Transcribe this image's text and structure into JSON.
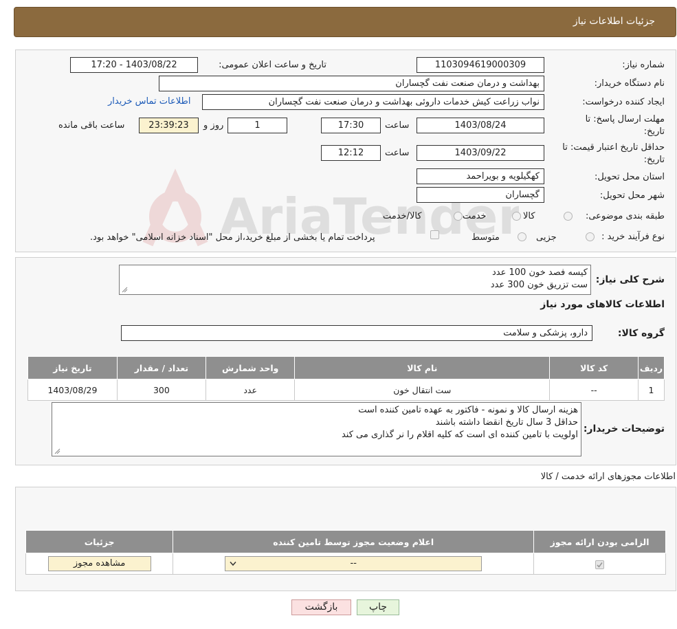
{
  "header": {
    "title": "جزئیات اطلاعات نیاز"
  },
  "form": {
    "need_number": {
      "label": "شماره نیاز:",
      "value": "1103094619000309"
    },
    "announce_datetime": {
      "label": "تاریخ و ساعت اعلان عمومی:",
      "value": "1403/08/22 - 17:20"
    },
    "buyer_org": {
      "label": "نام دستگاه خریدار:",
      "value": "بهداشت و درمان صنعت نفت گچساران"
    },
    "requester": {
      "label": "ایجاد کننده درخواست:",
      "value": "نواب زراعت کیش خدمات داروئی بهداشت و درمان صنعت نفت گچساران",
      "contact_link": "اطلاعات تماس خریدار"
    },
    "reply_deadline": {
      "label_line1": "مهلت ارسال پاسخ: تا",
      "label_line2": "تاریخ:",
      "date": "1403/08/24",
      "time_label": "ساعت",
      "time": "17:30",
      "days": "1",
      "days_label": "روز و",
      "remaining": "23:39:23",
      "remaining_label": "ساعت باقی مانده"
    },
    "price_validity": {
      "label_line1": "حداقل تاریخ اعتبار قیمت: تا",
      "label_line2": "تاریخ:",
      "date": "1403/09/22",
      "time_label": "ساعت",
      "time": "12:12"
    },
    "province": {
      "label": "استان محل تحویل:",
      "value": "کهگیلویه و بویراحمد"
    },
    "city": {
      "label": "شهر محل تحویل:",
      "value": "گچساران"
    },
    "category": {
      "label": "طبقه بندی موضوعی:",
      "options": [
        "کالا",
        "خدمت",
        "کالا/خدمت"
      ]
    },
    "process_type": {
      "label": "نوع فرآیند خرید :",
      "options": [
        "جزیی",
        "متوسط"
      ],
      "note": "پرداخت تمام یا بخشی از مبلغ خرید،از محل \"اسناد خزانه اسلامی\" خواهد بود."
    }
  },
  "summary": {
    "label": "شرح کلی نیاز:",
    "lines": [
      "کیسه فصد خون  100 عدد",
      "ست تزریق خون  300 عدد"
    ]
  },
  "goods": {
    "section_title": "اطلاعات کالاهای مورد نیاز",
    "group_label": "گروه کالا:",
    "group_value": "دارو، پزشکی و سلامت",
    "table": {
      "headers": [
        "ردیف",
        "کد کالا",
        "نام کالا",
        "واحد شمارش",
        "تعداد / مقدار",
        "تاریخ نیاز"
      ],
      "rows": [
        [
          "1",
          "--",
          "ست انتقال خون",
          "عدد",
          "300",
          "1403/08/29"
        ]
      ]
    }
  },
  "buyer_notes": {
    "label": "توضیحات خریدار:",
    "lines": [
      "هزینه ارسال کالا و نمونه - فاکتور به عهده تامین کننده است",
      "حداقل 3 سال تاریخ انقضا داشته باشند",
      "اولویت با تامین کننده ای است که کلیه اقلام را نر گذاری می کند"
    ]
  },
  "permits": {
    "section_title": "اطلاعات مجوزهای ارائه خدمت / کالا",
    "headers": [
      "الزامی بودن ارائه مجوز",
      "اعلام وضعیت مجوز توسط تامین کننده",
      "جزئیات"
    ],
    "select_value": "--",
    "view_button": "مشاهده مجوز"
  },
  "buttons": {
    "print": "چاپ",
    "back": "بازگشت"
  },
  "watermark": "AriaTender.neT"
}
